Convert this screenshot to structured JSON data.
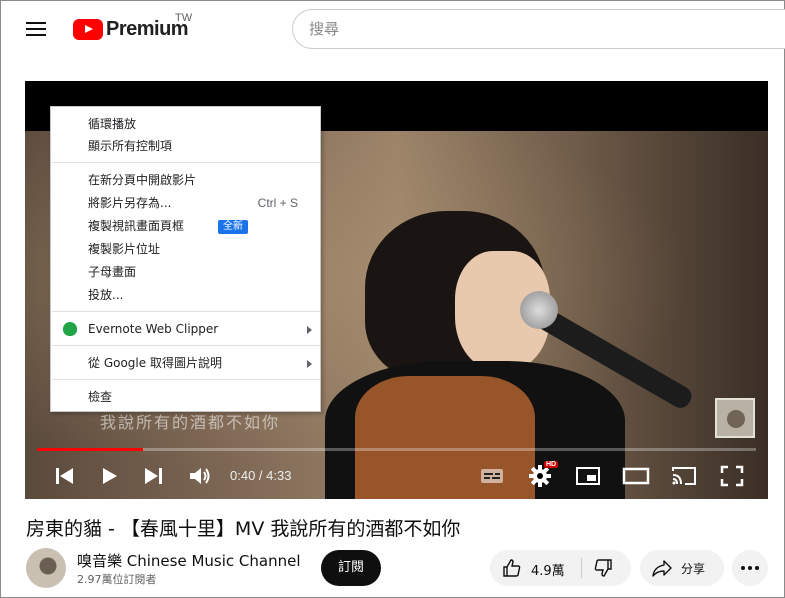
{
  "header": {
    "logo_text": "Premium",
    "region": "TW",
    "search_placeholder": "搜尋"
  },
  "player": {
    "subtitle": "我說所有的酒都不如你",
    "time": "0:40 / 4:33",
    "progress_fraction": 0.148,
    "hd_badge": "HD"
  },
  "context_menu": {
    "items": [
      {
        "label": "循環播放"
      },
      {
        "label": "顯示所有控制項"
      },
      {
        "label": "在新分頁中開啟影片"
      },
      {
        "label": "將影片另存為...",
        "shortcut": "Ctrl + S"
      },
      {
        "label": "複製視訊畫面頁框",
        "badge": "全新"
      },
      {
        "label": "複製影片位址"
      },
      {
        "label": "子母畫面"
      },
      {
        "label": "投放..."
      },
      {
        "label": "Evernote Web Clipper"
      },
      {
        "label": "從 Google 取得圖片說明"
      },
      {
        "label": "檢查"
      }
    ]
  },
  "video": {
    "title": "房東的貓 - 【春風十里】MV 我說所有的酒都不如你",
    "channel_name": "嗅音樂 Chinese Music Channel",
    "subscribers": "2.97萬位訂閱者",
    "subscribe_label": "訂閱",
    "likes": "4.9萬",
    "share_label": "分享"
  },
  "colors": {
    "brand_red": "#ff0000",
    "new_badge": "#1a73e8",
    "evernote_green": "#20a546"
  }
}
